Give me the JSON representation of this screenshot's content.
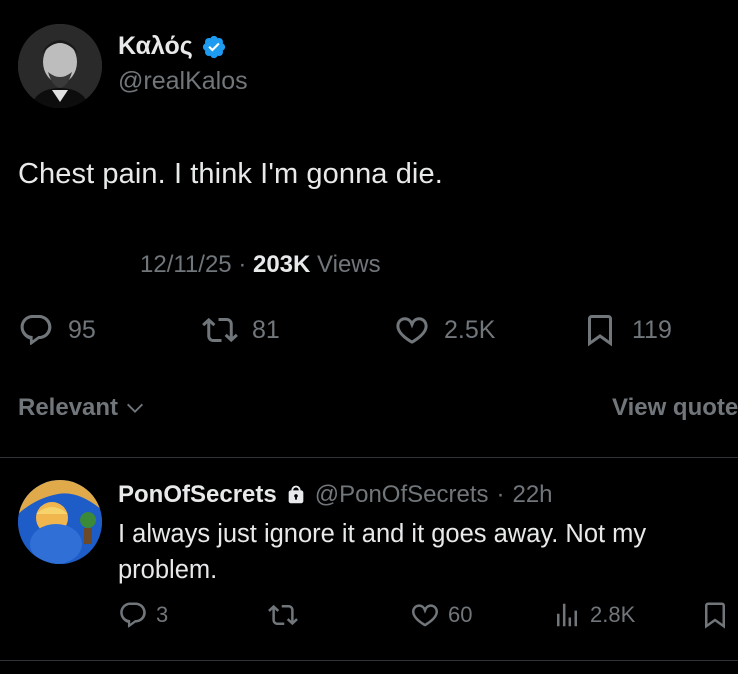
{
  "tweet": {
    "author": {
      "name": "Καλός",
      "handle": "@realKalos",
      "verified": true
    },
    "text": "Chest pain. I think I'm gonna die.",
    "date": "12/11/25",
    "separator": "·",
    "views_count": "203K",
    "views_label": "Views",
    "actions": {
      "replies": "95",
      "reposts": "81",
      "likes": "2.5K",
      "bookmarks": "119"
    }
  },
  "sort": {
    "label": "Relevant",
    "view_quotes": "View quotes"
  },
  "reply": {
    "author": {
      "name": "PonOfSecrets",
      "handle": "@PonOfSecrets",
      "separator": "·",
      "time": "22h",
      "protected": true
    },
    "text": "I always just ignore it and it goes away. Not my problem.",
    "actions": {
      "replies": "3",
      "reposts": "",
      "likes": "60",
      "views": "2.8K"
    }
  },
  "colors": {
    "background": "#000000",
    "text": "#e7e9ea",
    "muted": "#71767b",
    "verified": "#1d9bf0",
    "divider": "#2f3336"
  }
}
